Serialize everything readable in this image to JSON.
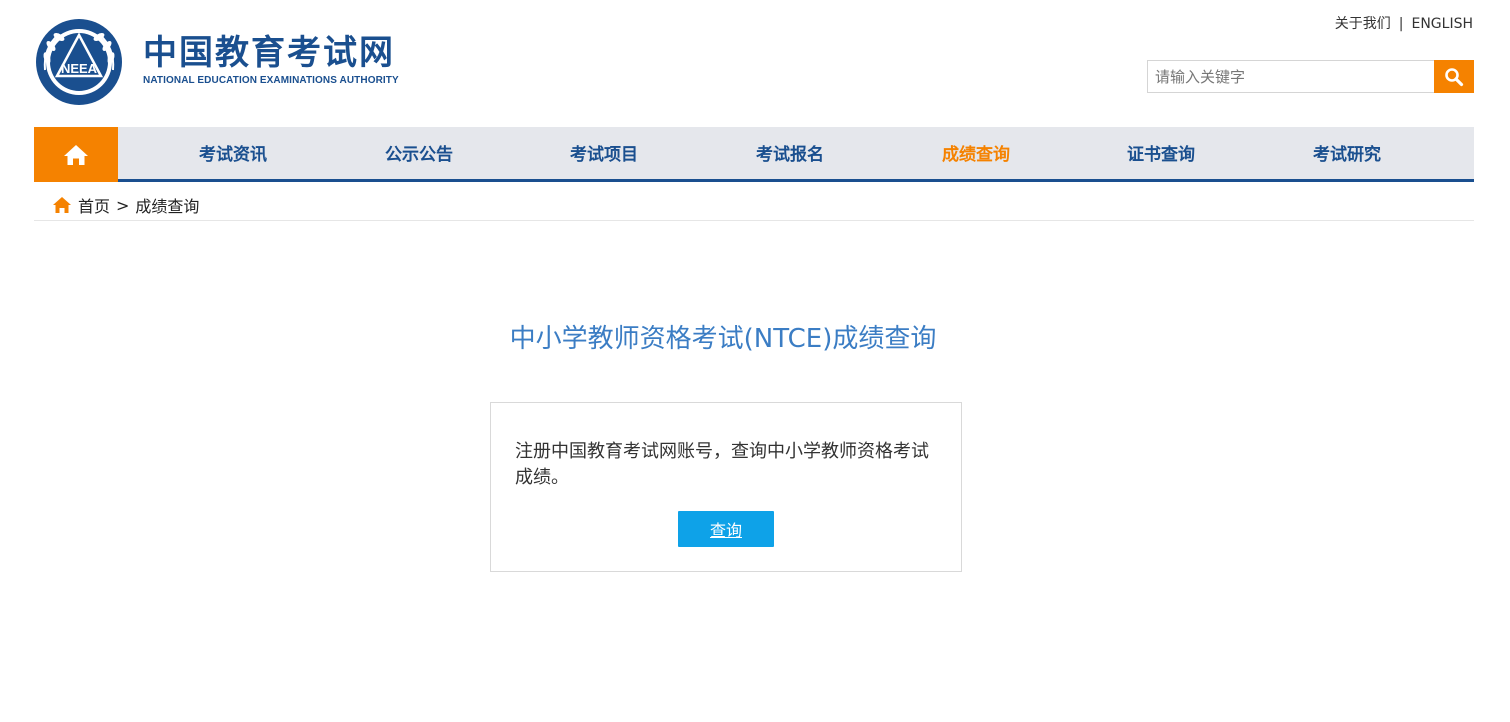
{
  "header": {
    "title": "中国教育考试网",
    "subtitle": "NATIONAL EDUCATION EXAMINATIONS AUTHORITY",
    "emblem_text": "NEEA",
    "about_label": "关于我们",
    "separator": "|",
    "english_label": "ENGLISH",
    "search": {
      "placeholder": "请输入关键字",
      "value": ""
    },
    "brand_color": "#1a4f8f",
    "accent_color": "#f58200"
  },
  "nav": {
    "home_icon": "home-icon",
    "items": [
      {
        "label": "考试资讯",
        "active": false
      },
      {
        "label": "公示公告",
        "active": false
      },
      {
        "label": "考试项目",
        "active": false
      },
      {
        "label": "考试报名",
        "active": false
      },
      {
        "label": "成绩查询",
        "active": true
      },
      {
        "label": "证书查询",
        "active": false
      },
      {
        "label": "考试研究",
        "active": false
      }
    ]
  },
  "breadcrumb": {
    "home": "首页",
    "separator": ">",
    "current": "成绩查询"
  },
  "main": {
    "title": "中小学教师资格考试(NTCE)成绩查询",
    "card": {
      "text": "注册中国教育考试网账号，查询中小学教师资格考试成绩。",
      "button_label": "查询"
    }
  }
}
